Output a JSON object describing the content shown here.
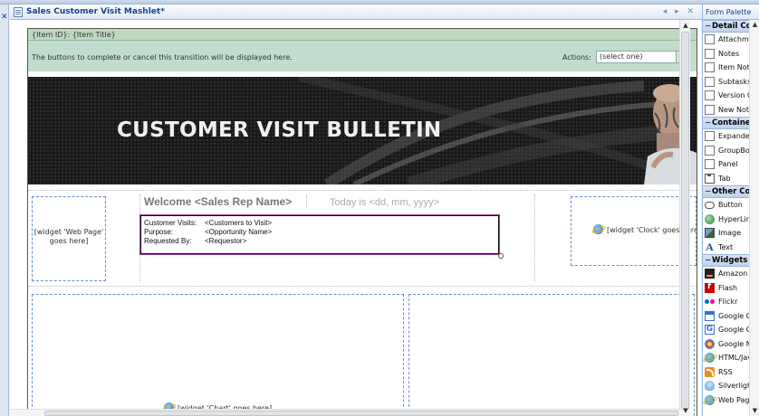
{
  "tab": {
    "title": "Sales Customer Visit Mashlet*",
    "controls": "◂ ▸ ✕"
  },
  "left_panel": {
    "close": "✕"
  },
  "form": {
    "item_header": "{Item ID}: {Item Title}",
    "transition_text": "The buttons to complete or cancel this transition will be displayed here.",
    "actions_label": "Actions:",
    "actions_value": "(select one)",
    "banner_title": "CUSTOMER VISIT BULLETIN",
    "web_widget": "[widget 'Web Page' goes here]",
    "welcome": "Welcome <Sales Rep Name>",
    "today": "Today is <dd, mm, yyyy>",
    "visit_rows": [
      {
        "label": "Customer Visits:",
        "value": "<Customers to Visit>"
      },
      {
        "label": "Purpose:",
        "value": "<Opportunity Name>"
      },
      {
        "label": "Requested By:",
        "value": "<Requestor>"
      }
    ],
    "clock_widget": "[widget 'Clock' goes here]",
    "chart_widget": "[widget 'Chart' goes here]"
  },
  "palette": {
    "title": "Form Palette",
    "groups": [
      {
        "label": "Detail Controls",
        "items": [
          {
            "icon": "checkbox-icon",
            "label": "Attachments"
          },
          {
            "icon": "checkbox-icon",
            "label": "Notes"
          },
          {
            "icon": "checkbox-icon",
            "label": "Item Notifications"
          },
          {
            "icon": "checkbox-icon",
            "label": "Subtasks"
          },
          {
            "icon": "checkbox-icon",
            "label": "Version Control"
          },
          {
            "icon": "checkbox-icon",
            "label": "New Note"
          }
        ]
      },
      {
        "label": "Container",
        "items": [
          {
            "icon": "checkbox-icon",
            "label": "Expander"
          },
          {
            "icon": "checkbox-icon",
            "label": "GroupBox"
          },
          {
            "icon": "checkbox-icon",
            "label": "Panel"
          },
          {
            "icon": "tab-icon",
            "label": "Tab"
          }
        ]
      },
      {
        "label": "Other Controls",
        "items": [
          {
            "icon": "button-icon",
            "label": "Button"
          },
          {
            "icon": "hyperlink-icon",
            "label": "HyperLink"
          },
          {
            "icon": "image-icon",
            "label": "Image"
          },
          {
            "icon": "text-icon",
            "label": "Text"
          }
        ]
      },
      {
        "label": "Widgets",
        "items": [
          {
            "icon": "amazon-icon",
            "label": "Amazon Search"
          },
          {
            "icon": "flash-icon",
            "label": "Flash"
          },
          {
            "icon": "flickr-icon",
            "label": "Flickr"
          },
          {
            "icon": "google-calendar-icon",
            "label": "Google Calendar"
          },
          {
            "icon": "google-gadget-icon",
            "label": "Google Gadget"
          },
          {
            "icon": "google-maps-icon",
            "label": "Google Maps"
          },
          {
            "icon": "html-javascript-icon",
            "label": "HTML/JavaScript"
          },
          {
            "icon": "rss-icon",
            "label": "RSS"
          },
          {
            "icon": "silverlight-icon",
            "label": "Silverlight"
          },
          {
            "icon": "web-page-icon",
            "label": "Web Page"
          }
        ]
      }
    ]
  },
  "colors": {
    "header_blue": "#15428b",
    "form_green": "#c2dccd",
    "banner_dark": "#191919",
    "selection_purple": "#a23ca2"
  }
}
